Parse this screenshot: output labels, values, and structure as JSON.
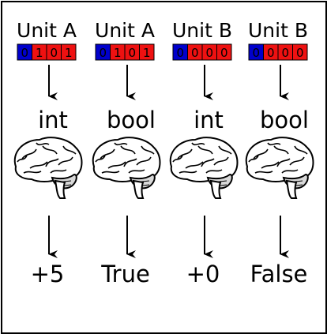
{
  "colors": {
    "border": "#000000",
    "sign_bit": "#0000cc",
    "value_bits": "#ee1111",
    "bit_text": "#000000",
    "arrow": "#000000"
  },
  "columns": [
    {
      "unit": "Unit A",
      "bits": [
        "0",
        "1",
        "0",
        "1"
      ],
      "type": "int",
      "brain_icon": "brain-icon",
      "result": "+5"
    },
    {
      "unit": "Unit A",
      "bits": [
        "0",
        "1",
        "0",
        "1"
      ],
      "type": "bool",
      "brain_icon": "brain-icon",
      "result": "True"
    },
    {
      "unit": "Unit B",
      "bits": [
        "0",
        "0",
        "0",
        "0"
      ],
      "type": "int",
      "brain_icon": "brain-icon",
      "result": "+0"
    },
    {
      "unit": "Unit B",
      "bits": [
        "0",
        "0",
        "0",
        "0"
      ],
      "type": "bool",
      "brain_icon": "brain-icon",
      "result": "False"
    }
  ]
}
